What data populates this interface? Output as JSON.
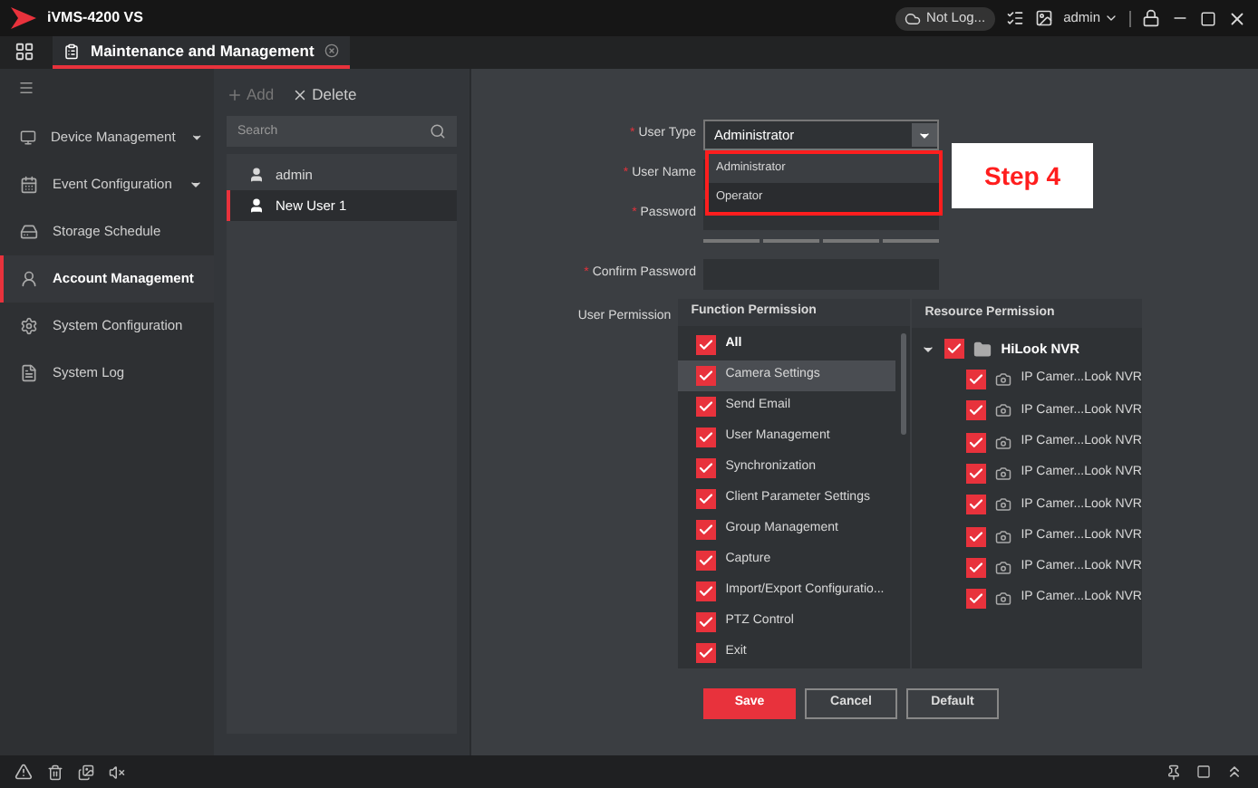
{
  "window": {
    "title": "iVMS-4200 VS",
    "cloud_status": "Not Log...",
    "user": "admin"
  },
  "tabs": [
    {
      "label": "Maintenance and Management",
      "selected": true
    }
  ],
  "sidebar": {
    "items": [
      {
        "label": "Device Management",
        "has_submenu": true,
        "selected": false
      },
      {
        "label": "Event Configuration",
        "has_submenu": true,
        "selected": false
      },
      {
        "label": "Storage Schedule",
        "has_submenu": false,
        "selected": false
      },
      {
        "label": "Account Management",
        "has_submenu": false,
        "selected": true
      },
      {
        "label": "System Configuration",
        "has_submenu": false,
        "selected": false
      },
      {
        "label": "System Log",
        "has_submenu": false,
        "selected": false
      }
    ]
  },
  "user_panel": {
    "add": "Add",
    "delete": "Delete",
    "search_placeholder": "Search",
    "users": [
      {
        "name": "admin",
        "selected": false
      },
      {
        "name": "New User 1",
        "selected": true
      }
    ]
  },
  "form": {
    "user_type": {
      "required_mark": "*",
      "label": "User Type",
      "value": "Administrator",
      "expanded": true,
      "options": [
        {
          "label": "Administrator",
          "selected": true
        },
        {
          "label": "Operator",
          "selected": false
        }
      ]
    },
    "user_name": {
      "required_mark": "*",
      "label": "User Name"
    },
    "password": {
      "required_mark": "*",
      "label": "Password"
    },
    "confirm_password": {
      "required_mark": "*",
      "label": "Confirm Password"
    },
    "permission_label": "User Permission",
    "function_permission": {
      "title": "Function Permission",
      "items": [
        {
          "label": "All",
          "checked": true,
          "selected": false,
          "bold": true
        },
        {
          "label": "Camera Settings",
          "checked": true,
          "selected": true,
          "bold": false
        },
        {
          "label": "Send Email",
          "checked": true,
          "selected": false,
          "bold": false
        },
        {
          "label": "User Management",
          "checked": true,
          "selected": false,
          "bold": false
        },
        {
          "label": "Synchronization",
          "checked": true,
          "selected": false,
          "bold": false
        },
        {
          "label": "Client Parameter Settings",
          "checked": true,
          "selected": false,
          "bold": false
        },
        {
          "label": "Group Management",
          "checked": true,
          "selected": false,
          "bold": false
        },
        {
          "label": "Capture",
          "checked": true,
          "selected": false,
          "bold": false
        },
        {
          "label": "Import/Export Configuratio...",
          "checked": true,
          "selected": false,
          "bold": false
        },
        {
          "label": "PTZ Control",
          "checked": true,
          "selected": false,
          "bold": false
        },
        {
          "label": "Exit",
          "checked": true,
          "selected": false,
          "bold": false
        }
      ]
    },
    "resource_permission": {
      "title": "Resource Permission",
      "root": {
        "label": "HiLook NVR",
        "checked": true,
        "expanded": true,
        "children": [
          {
            "label": "IP Camer...Look NVR",
            "checked": true
          },
          {
            "label": "IP Camer...Look NVR",
            "checked": true
          },
          {
            "label": "IP Camer...Look NVR",
            "checked": true
          },
          {
            "label": "IP Camer...Look NVR",
            "checked": true
          },
          {
            "label": "IP Camer...Look NVR",
            "checked": true
          },
          {
            "label": "IP Camer...Look NVR",
            "checked": true
          },
          {
            "label": "IP Camer...Look NVR",
            "checked": true
          },
          {
            "label": "IP Camer...Look NVR",
            "checked": true
          }
        ]
      }
    },
    "buttons": [
      {
        "label": "Save",
        "kind": "primary"
      },
      {
        "label": "Cancel",
        "kind": "secondary"
      },
      {
        "label": "Default",
        "kind": "secondary"
      }
    ]
  },
  "annotation": {
    "label": "Step 4"
  }
}
